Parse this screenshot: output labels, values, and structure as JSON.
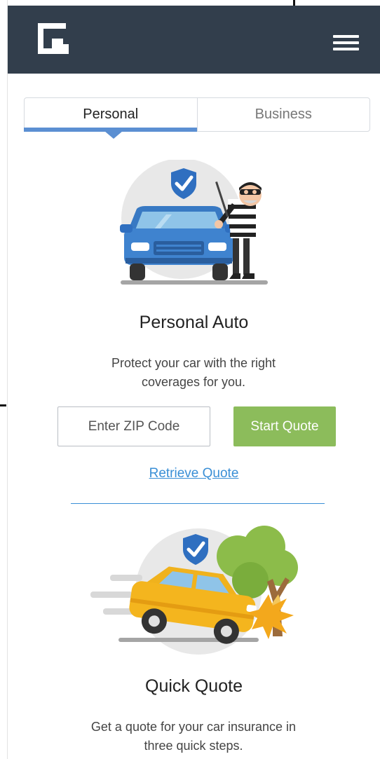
{
  "header": {
    "logo_icon": "brand-logo-icon",
    "menu_icon": "hamburger-menu-icon",
    "background": "#323e4c"
  },
  "tabs": [
    {
      "label": "Personal",
      "active": true
    },
    {
      "label": "Business",
      "active": false
    }
  ],
  "accent_color": "#5b8fd2",
  "personal_auto": {
    "title": "Personal Auto",
    "description": "Protect your car with the right coverages for you.",
    "zip_placeholder": "Enter ZIP Code",
    "start_label": "Start Quote",
    "start_color": "#8cbc5b",
    "retrieve_label": "Retrieve Quote"
  },
  "quick_quote": {
    "title": "Quick Quote",
    "description": "Get a quote for your car insurance in three quick steps."
  }
}
